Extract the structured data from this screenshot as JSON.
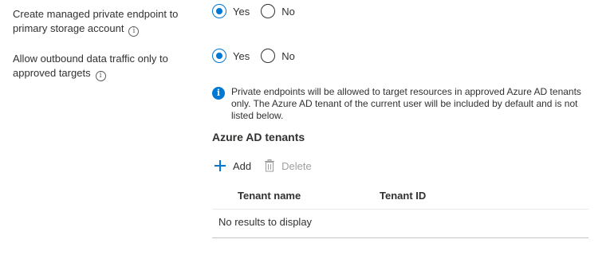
{
  "settings": [
    {
      "label": "Create managed private endpoint to primary storage account",
      "options": {
        "yes": "Yes",
        "no": "No"
      },
      "selected": "yes"
    },
    {
      "label": "Allow outbound data traffic only to approved targets",
      "options": {
        "yes": "Yes",
        "no": "No"
      },
      "selected": "yes"
    }
  ],
  "info_message": "Private endpoints will be allowed to target resources in approved Azure AD tenants only. The Azure AD tenant of the current user will be included by default and is not listed below.",
  "section": {
    "title": "Azure AD tenants"
  },
  "toolbar": {
    "add_label": "Add",
    "delete_label": "Delete"
  },
  "grid": {
    "columns": [
      "Tenant name",
      "Tenant ID"
    ],
    "empty_text": "No results to display"
  },
  "colors": {
    "accent": "#0078d4",
    "text": "#323130",
    "disabled": "#a19f9d"
  },
  "icons": {
    "info": "info-icon",
    "info_badge": "info-circle-filled-icon",
    "add": "plus-icon",
    "delete": "trash-icon"
  }
}
